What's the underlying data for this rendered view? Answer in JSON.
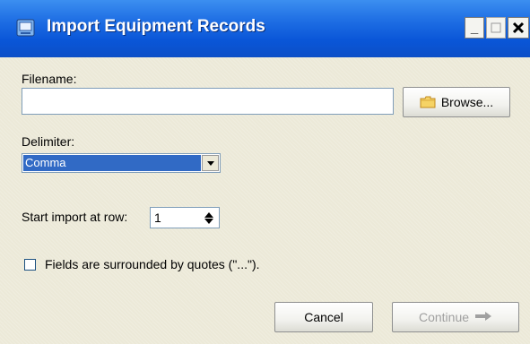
{
  "window": {
    "title": "Import Equipment Records",
    "controls": {
      "minimize": "_",
      "maximize": "□",
      "close": "×"
    }
  },
  "form": {
    "filename_label": "Filename:",
    "filename_value": "",
    "browse_label": "Browse...",
    "delimiter_label": "Delimiter:",
    "delimiter_value": "Comma",
    "start_row_label": "Start import at row:",
    "start_row_value": "1",
    "quotes_label": "Fields are surrounded by quotes (\"...\").",
    "quotes_checked": false
  },
  "buttons": {
    "cancel": "Cancel",
    "continue": "Continue",
    "continue_enabled": false
  },
  "icons": {
    "title": "app-icon",
    "browse": "folder-icon",
    "continue": "arrow-right-icon"
  },
  "colors": {
    "titlebar": "#0a56d8",
    "selection": "#316ac5",
    "dialog_bg": "#ece9d8"
  }
}
